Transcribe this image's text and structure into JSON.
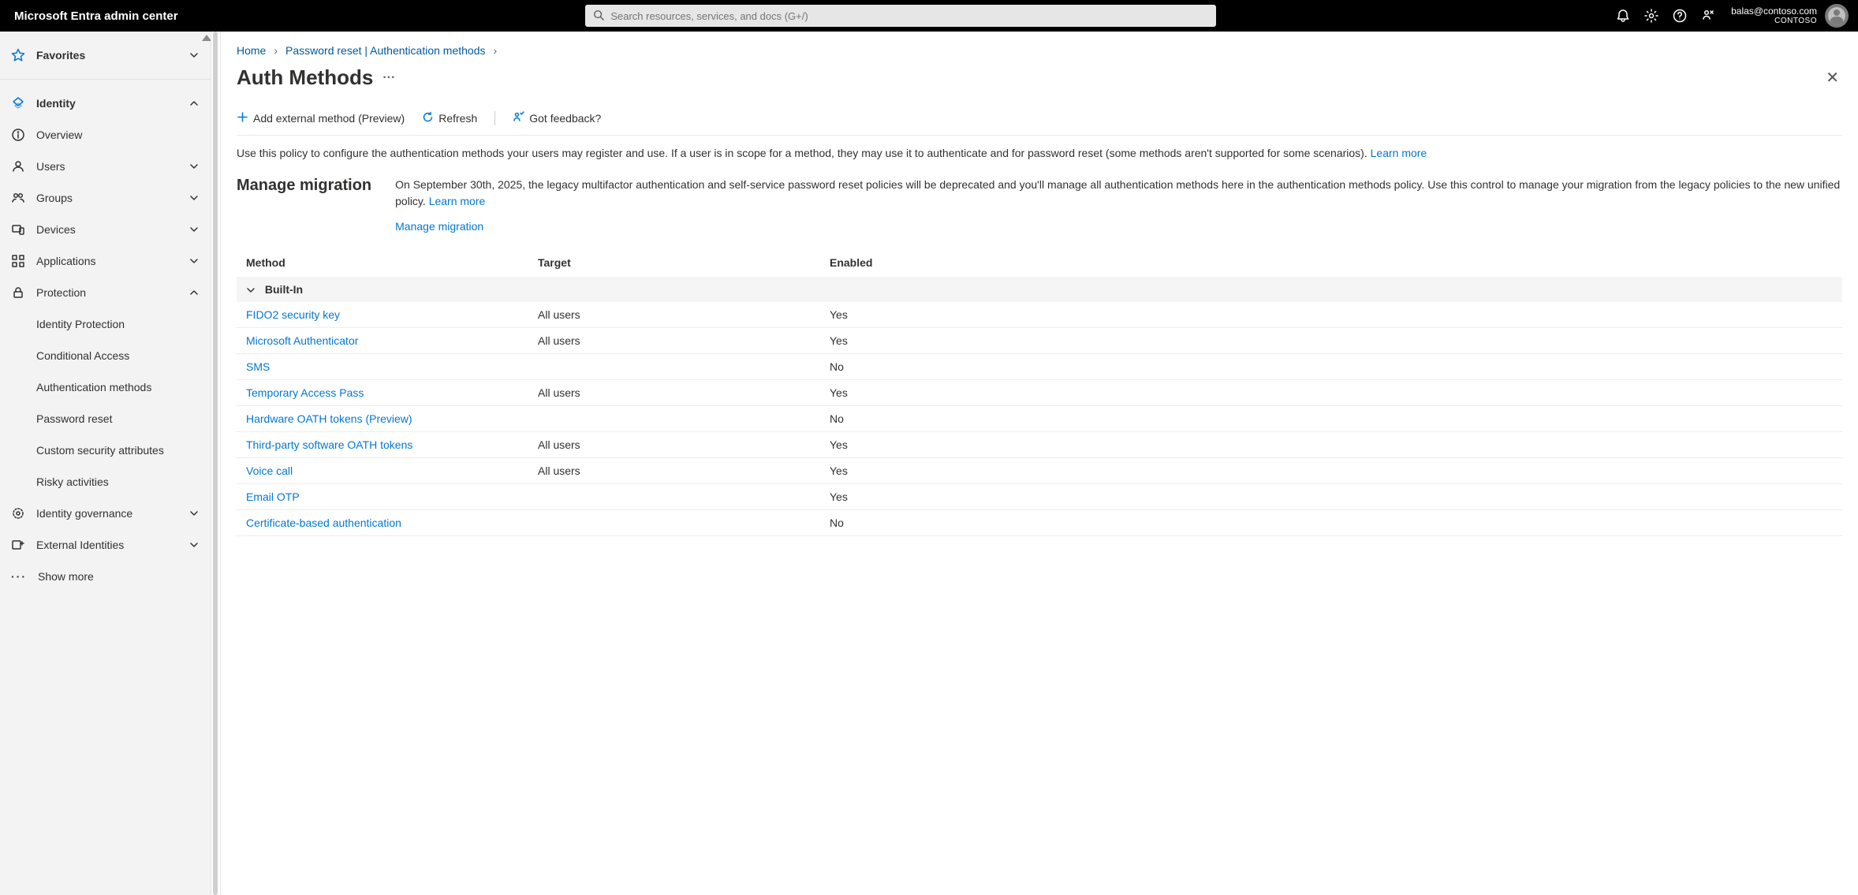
{
  "brand": "Microsoft Entra admin center",
  "search": {
    "placeholder": "Search resources, services, and docs (G+/)"
  },
  "account": {
    "email": "balas@contoso.com",
    "tenant": "CONTOSO"
  },
  "sidebar": {
    "favorites": "Favorites",
    "identity": "Identity",
    "identity_items": {
      "overview": "Overview",
      "users": "Users",
      "groups": "Groups",
      "devices": "Devices",
      "applications": "Applications",
      "protection": "Protection"
    },
    "protection_items": {
      "idprot": "Identity Protection",
      "condaccess": "Conditional Access",
      "authmethods": "Authentication methods",
      "pwdreset": "Password reset",
      "customsec": "Custom security attributes",
      "risky": "Risky activities"
    },
    "idgov": "Identity governance",
    "extid": "External Identities",
    "showmore": "Show more"
  },
  "breadcrumb": {
    "home": "Home",
    "pwdreset": "Password reset | Authentication methods"
  },
  "title": "Auth Methods",
  "toolbar": {
    "add_external": "Add external method (Preview)",
    "refresh": "Refresh",
    "feedback": "Got feedback?"
  },
  "description": {
    "text": "Use this policy to configure the authentication methods your users may register and use. If a user is in scope for a method, they may use it to authenticate and for password reset (some methods aren't supported for some scenarios). ",
    "learn": "Learn more"
  },
  "migration": {
    "heading": "Manage migration",
    "text": "On September 30th, 2025, the legacy multifactor authentication and self-service password reset policies will be deprecated and you'll manage all authentication methods here in the authentication methods policy. Use this control to manage your migration from the legacy policies to the new unified policy. ",
    "learn": "Learn more",
    "manage_link": "Manage migration"
  },
  "table": {
    "headers": {
      "method": "Method",
      "target": "Target",
      "enabled": "Enabled"
    },
    "group": "Built-In",
    "rows": [
      {
        "method": "FIDO2 security key",
        "target": "All users",
        "enabled": "Yes"
      },
      {
        "method": "Microsoft Authenticator",
        "target": "All users",
        "enabled": "Yes"
      },
      {
        "method": "SMS",
        "target": "",
        "enabled": "No"
      },
      {
        "method": "Temporary Access Pass",
        "target": "All users",
        "enabled": "Yes"
      },
      {
        "method": "Hardware OATH tokens (Preview)",
        "target": "",
        "enabled": "No"
      },
      {
        "method": "Third-party software OATH tokens",
        "target": "All users",
        "enabled": "Yes"
      },
      {
        "method": "Voice call",
        "target": "All users",
        "enabled": "Yes"
      },
      {
        "method": "Email OTP",
        "target": "",
        "enabled": "Yes"
      },
      {
        "method": "Certificate-based authentication",
        "target": "",
        "enabled": "No"
      }
    ]
  }
}
